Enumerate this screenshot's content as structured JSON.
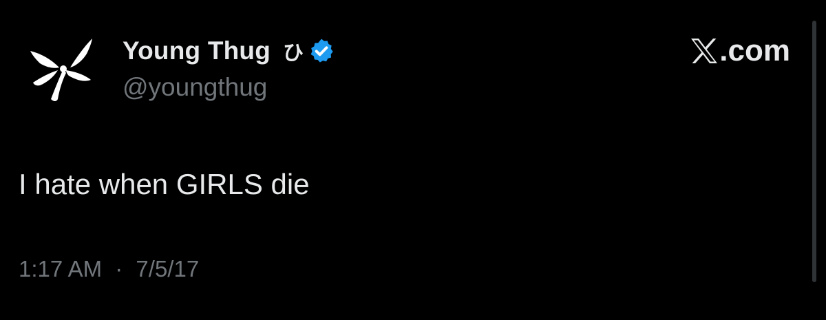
{
  "author": {
    "display_name": "Young Thug",
    "name_emoji": "ひ",
    "handle": "@youngthug",
    "verified": true,
    "avatar_icon": "butterfly-logo-icon"
  },
  "brand": {
    "logo_icon": "x-logo-icon",
    "suffix": ".com"
  },
  "tweet": {
    "text": "I hate when GIRLS die",
    "time": "1:17 AM",
    "separator": "·",
    "date": "7/5/17"
  },
  "colors": {
    "background": "#000000",
    "primary_text": "#e7e9ea",
    "secondary_text": "#71767b",
    "verified_badge": "#1d9bf0"
  }
}
